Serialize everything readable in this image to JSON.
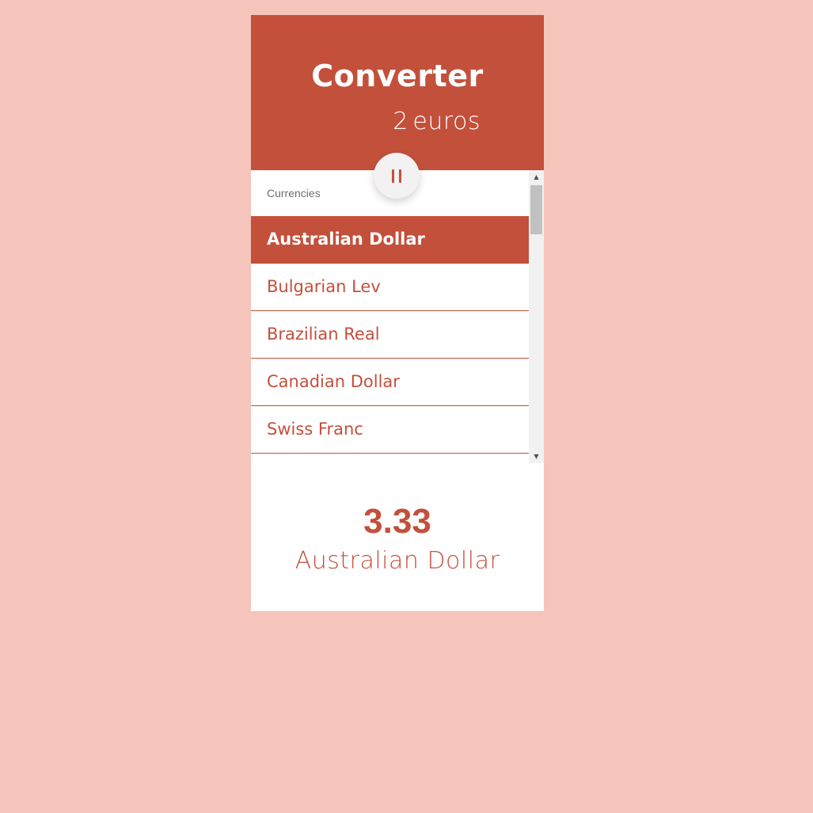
{
  "header": {
    "title": "Converter",
    "amount": "2",
    "amount_unit": "euros"
  },
  "swap_button": {
    "icon": "pause-icon"
  },
  "list": {
    "heading": "Currencies",
    "items": [
      {
        "label": "Australian Dollar",
        "selected": true
      },
      {
        "label": "Bulgarian Lev",
        "selected": false
      },
      {
        "label": "Brazilian Real",
        "selected": false
      },
      {
        "label": "Canadian Dollar",
        "selected": false
      },
      {
        "label": "Swiss Franc",
        "selected": false
      }
    ]
  },
  "scrollbar": {
    "up_arrow": "▲",
    "down_arrow": "▼"
  },
  "result": {
    "value": "3.33",
    "currency": "Australian Dollar"
  },
  "colors": {
    "background": "#f5c4bb",
    "accent": "#c3503b",
    "card": "#ffffff"
  }
}
